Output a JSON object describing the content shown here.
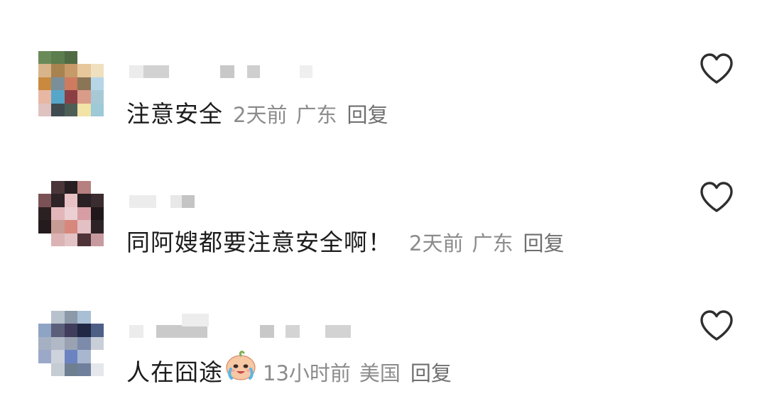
{
  "comments": [
    {
      "content": "注意安全",
      "time": "2天前",
      "location": "广东",
      "reply": "回复",
      "avatar_icon": "pixelated-avatar-1",
      "emoji": ""
    },
    {
      "content": "同阿嫂都要注意安全啊！",
      "time": "2天前",
      "location": "广东",
      "reply": "回复",
      "avatar_icon": "pixelated-avatar-2",
      "emoji": ""
    },
    {
      "content": "人在囧途",
      "time": "13小时前",
      "location": "美国",
      "reply": "回复",
      "avatar_icon": "pixelated-avatar-3",
      "emoji": "crying-face-emoji"
    }
  ],
  "like_icon": "heart-outline-icon"
}
